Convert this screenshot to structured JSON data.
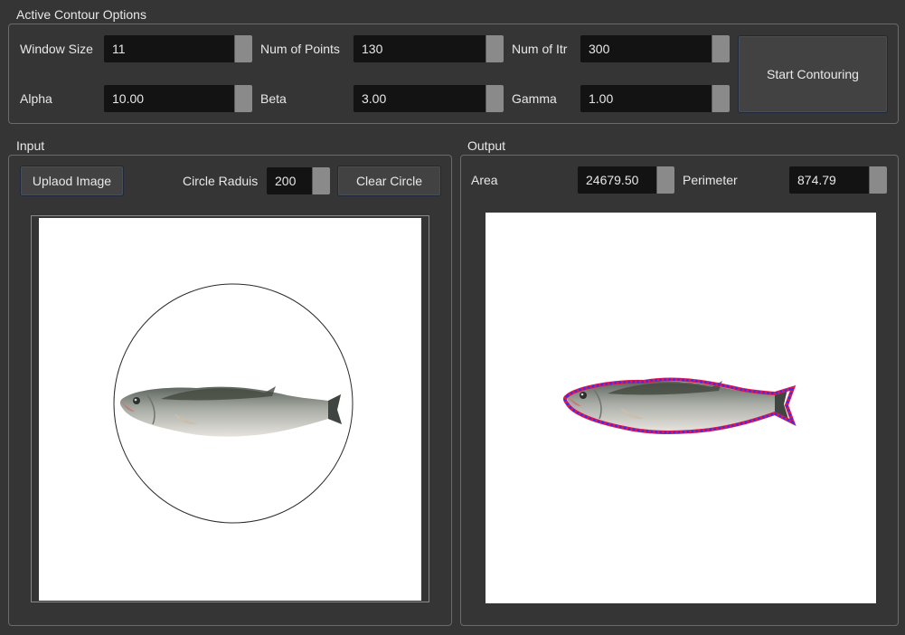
{
  "active_contour": {
    "title": "Active Contour Options",
    "window_size": {
      "label": "Window Size",
      "value": "11"
    },
    "num_points": {
      "label": "Num of Points",
      "value": "130"
    },
    "num_itr": {
      "label": "Num of Itr",
      "value": "300"
    },
    "alpha": {
      "label": "Alpha",
      "value": "10.00"
    },
    "beta": {
      "label": "Beta",
      "value": "3.00"
    },
    "gamma": {
      "label": "Gamma",
      "value": "1.00"
    },
    "start_button": "Start Contouring"
  },
  "input": {
    "title": "Input",
    "upload_button": "Uplaod Image",
    "circle_radius": {
      "label": "Circle Raduis",
      "value": "200"
    },
    "clear_button": "Clear Circle"
  },
  "output": {
    "title": "Output",
    "area": {
      "label": "Area",
      "value": "24679.50"
    },
    "perimeter": {
      "label": "Perimeter",
      "value": "874.79"
    }
  },
  "colors": {
    "background": "#353535",
    "field": "#131313",
    "contour_outer": "#e0194a",
    "contour_inner": "#3030ff"
  },
  "icons": {
    "fish_image": "fish-photo"
  }
}
